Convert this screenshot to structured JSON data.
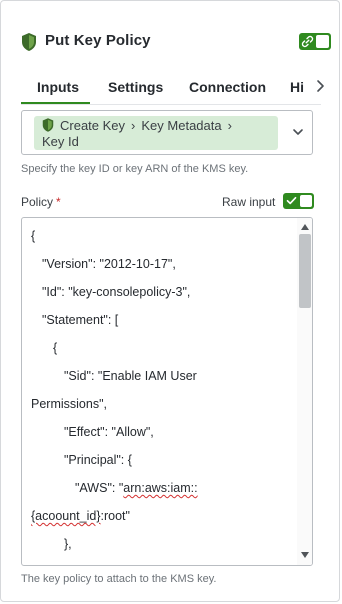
{
  "header": {
    "title": "Put Key Policy",
    "icon": "kms-shield-icon",
    "link_toggle_icon": "link-icon",
    "accent_color": "#2f8a1f"
  },
  "tabs": [
    {
      "label": "Inputs",
      "active": true
    },
    {
      "label": "Settings",
      "active": false
    },
    {
      "label": "Connection",
      "active": false
    },
    {
      "label": "Hi",
      "active": false
    }
  ],
  "key_field": {
    "breadcrumb": [
      "Create Key",
      "Key Metadata",
      "Key Id"
    ],
    "hint": "Specify the key ID or key ARN of the KMS key."
  },
  "policy": {
    "label": "Policy",
    "required_marker": "*",
    "raw_input_label": "Raw input",
    "raw_input_enabled": true,
    "hint": "The key policy to attach to the KMS key.",
    "lines": [
      "{",
      "\"Version\": \"2012-10-17\",",
      "\"Id\": \"key-consolepolicy-3\",",
      "\"Statement\": [",
      "{",
      "\"Sid\": \"Enable IAM User",
      "Permissions\",",
      "\"Effect\": \"Allow\",",
      "\"Principal\": {",
      "\"AWS\": \"",
      "arn:aws:iam::",
      "{acoount_id}",
      ":root\"",
      "},"
    ]
  }
}
